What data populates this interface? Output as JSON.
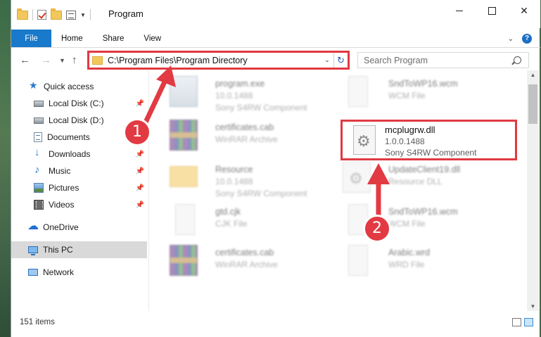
{
  "window": {
    "title": "Program"
  },
  "ribbon": {
    "tabs": [
      "File",
      "Home",
      "Share",
      "View"
    ]
  },
  "address": {
    "path": "C:\\Program Files\\Program Directory",
    "search_placeholder": "Search Program"
  },
  "sidebar": {
    "items": [
      {
        "label": "Quick access",
        "icon": "star-icon"
      },
      {
        "label": "Local Disk (C:)",
        "icon": "disk-icon",
        "pinned": true
      },
      {
        "label": "Local Disk (D:)",
        "icon": "disk-icon"
      },
      {
        "label": "Documents",
        "icon": "documents-icon",
        "pinned": true
      },
      {
        "label": "Downloads",
        "icon": "downloads-icon",
        "pinned": true
      },
      {
        "label": "Music",
        "icon": "music-icon",
        "pinned": true
      },
      {
        "label": "Pictures",
        "icon": "pictures-icon",
        "pinned": true
      },
      {
        "label": "Videos",
        "icon": "videos-icon",
        "pinned": true
      },
      {
        "label": "OneDrive",
        "icon": "onedrive-icon"
      },
      {
        "label": "This PC",
        "icon": "pc-icon",
        "selected": true
      },
      {
        "label": "Network",
        "icon": "network-icon"
      }
    ]
  },
  "files": [
    {
      "name": "program.exe",
      "version": "10.0.1488",
      "desc": "Sony S4RW Component",
      "icon": "exe-icon"
    },
    {
      "name": "certificates.cab",
      "version": "WinRAR Archive",
      "desc": "",
      "icon": "rar-icon"
    },
    {
      "name": "Resource",
      "version": "10.0.1488",
      "desc": "Sony S4RW Component",
      "icon": "folder-icon"
    },
    {
      "name": "gtd.cjk",
      "version": "CJK File",
      "desc": "",
      "icon": "document-icon"
    },
    {
      "name": "certificates.cab",
      "version": "WinRAR Archive",
      "desc": "",
      "icon": "rar-icon"
    },
    {
      "name": "SndToWP16.wcm",
      "version": "WCM File",
      "desc": "",
      "icon": "document-icon"
    },
    {
      "name": "UpdateClient19.dll",
      "version": "Resource DLL",
      "desc": "",
      "icon": "gear-icon"
    },
    {
      "name": "SndToWP16.wcm",
      "version": "WCM File",
      "desc": "",
      "icon": "document-icon"
    },
    {
      "name": "Arabic.wrd",
      "version": "WRD File",
      "desc": "",
      "icon": "document-icon"
    }
  ],
  "highlighted_file": {
    "name": "mcplugrw.dll",
    "version": "1.0.0.1488",
    "desc": "Sony S4RW Component"
  },
  "annotations": {
    "step1": "1",
    "step2": "2",
    "color": "#e23a43"
  },
  "status": {
    "item_count": "151 items"
  }
}
